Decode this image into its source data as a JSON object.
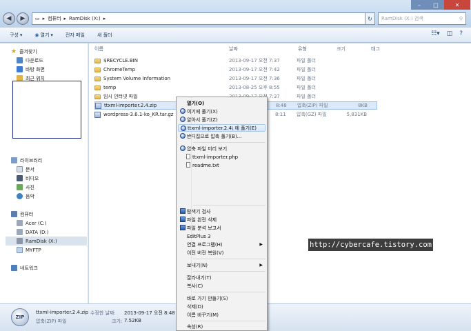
{
  "address": {
    "path": [
      "컴퓨터",
      "RamDisk (X:)"
    ]
  },
  "search": {
    "placeholder": "RamDisk (X:) 검색"
  },
  "toolbar": {
    "organize": "구성",
    "open": "열기",
    "email": "전자 메일",
    "new_folder": "새 폴더"
  },
  "columns": {
    "name": "이름",
    "date": "날짜",
    "type": "유형",
    "size": "크기",
    "tags": "태그"
  },
  "nav": {
    "favorites": "즐겨찾기",
    "downloads": "다운로드",
    "desktop": "바탕 화면",
    "recent": "최근 위치",
    "libraries": "라이브러리",
    "documents": "문서",
    "video": "비디오",
    "pictures": "사진",
    "music": "음악",
    "computer": "컴퓨터",
    "drive_c": "Acer (C:)",
    "drive_d": "DATA (D:)",
    "drive_x": "RamDisk (X:)",
    "myftp": "MYFTP",
    "network": "네트워크"
  },
  "files": [
    {
      "name": "$RECYCLE.BIN",
      "date": "2013-09-17 오전 7:37",
      "type": "파일 폴더",
      "size": ""
    },
    {
      "name": "ChromeTemp",
      "date": "2013-09-17 오전 7:42",
      "type": "파일 폴더",
      "size": ""
    },
    {
      "name": "System Volume Information",
      "date": "2013-09-17 오전 7:36",
      "type": "파일 폴더",
      "size": ""
    },
    {
      "name": "temp",
      "date": "2013-08-25 오후 8:55",
      "type": "파일 폴더",
      "size": ""
    },
    {
      "name": "임시 인터넷 파일",
      "date": "2013-09-17 오전 7:37",
      "type": "파일 폴더",
      "size": ""
    },
    {
      "name": "ttxml-importer.2.4.zip",
      "date": "8:48",
      "type": "압축(ZIP) 파일",
      "size": "8KB"
    },
    {
      "name": "wordpress-3.6.1-ko_KR.tar.gz",
      "date": "8:11",
      "type": "압축(GZ) 파일",
      "size": "5,831KB"
    }
  ],
  "context_menu": {
    "open": "열기(O)",
    "open_here": "여기에 풀기(X)",
    "extract_to": "알아서 풀기(Z)",
    "extract_folder": "ttxml-importer.2.4\\ 에 풀기(E)",
    "extract_dialog": "반디집으로 압축 풀기(B)...",
    "preview": "압축 파일 미리 보기",
    "preview_file1": "ttxml-importer.php",
    "preview_file2": "readme.txt",
    "scan": "탐색기 검사",
    "wipe": "파일 완전 삭제",
    "report": "파일 분석 보고서",
    "editplus": "EditPlus 3",
    "open_with": "연결 프로그램(H)",
    "restore": "이전 버전 복원(V)",
    "send_to": "보내기(N)",
    "cut": "잘라내기(T)",
    "copy": "복사(C)",
    "shortcut": "바로 가기 만들기(S)",
    "delete": "삭제(D)",
    "rename": "이름 바꾸기(M)",
    "properties": "속성(R)"
  },
  "status": {
    "filename": "ttxml-importer.2.4.zip",
    "modified_label": "수정한 날짜:",
    "modified_value": "2013-09-17 오전 8:48",
    "type": "압축(ZIP) 파일",
    "size_label": "크기:",
    "size_value": "7.52KB",
    "icon_text": "ZIP"
  },
  "watermark": "http://cybercafe.tistory.com",
  "icons": [
    "back-icon",
    "forward-icon",
    "refresh-icon",
    "search-icon",
    "star-icon",
    "folder-icon",
    "zip-icon",
    "computer-icon",
    "drive-icon",
    "network-icon",
    "chevron-down-icon",
    "chevron-right-icon"
  ]
}
